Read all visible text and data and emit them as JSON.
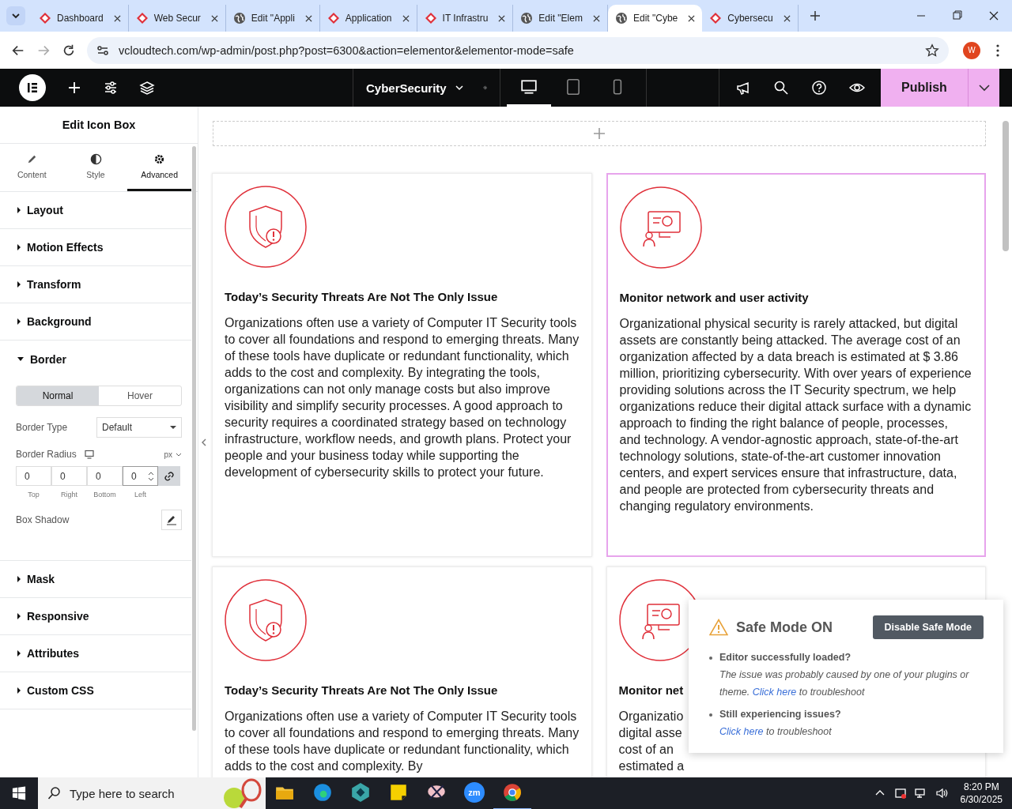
{
  "browser": {
    "tabs": [
      {
        "title": "Dashboard",
        "kind": "site",
        "selected": false
      },
      {
        "title": "Web Secur",
        "kind": "site",
        "selected": false
      },
      {
        "title": "Edit \"Appli",
        "kind": "globe",
        "selected": false
      },
      {
        "title": "Application",
        "kind": "site",
        "selected": false
      },
      {
        "title": "IT Infrastru",
        "kind": "site",
        "selected": false
      },
      {
        "title": "Edit \"Elem",
        "kind": "globe",
        "selected": false
      },
      {
        "title": "Edit \"Cybe",
        "kind": "globe",
        "selected": true
      },
      {
        "title": "Cybersecu",
        "kind": "site",
        "selected": false
      }
    ],
    "url": "vcloudtech.com/wp-admin/post.php?post=6300&action=elementor&elementor-mode=safe",
    "profile": "W"
  },
  "topbar": {
    "page_title": "CyberSecurity",
    "devices": [
      {
        "kind": "desktop",
        "selected": true
      },
      {
        "kind": "tablet",
        "selected": false
      },
      {
        "kind": "mobile",
        "selected": false
      }
    ],
    "publish": "Publish"
  },
  "panel": {
    "title": "Edit Icon Box",
    "tabs": [
      {
        "label": "Content",
        "kind": "content",
        "selected": false
      },
      {
        "label": "Style",
        "kind": "style",
        "selected": false
      },
      {
        "label": "Advanced",
        "kind": "advanced",
        "selected": true
      }
    ],
    "sections": [
      {
        "title": "Layout",
        "expanded": false
      },
      {
        "title": "Motion Effects",
        "expanded": false
      },
      {
        "title": "Transform",
        "expanded": false
      },
      {
        "title": "Background",
        "expanded": false
      },
      {
        "title": "Border",
        "expanded": true,
        "settings": {
          "states": [
            {
              "label": "Normal",
              "selected": true
            },
            {
              "label": "Hover",
              "selected": false
            }
          ],
          "border_type_label": "Border Type",
          "border_type": "Default",
          "radius_label": "Border Radius",
          "unit": "px",
          "radius": [
            {
              "value": "0",
              "label": "Top"
            },
            {
              "value": "0",
              "label": "Right"
            },
            {
              "value": "0",
              "label": "Bottom"
            },
            {
              "value": "0",
              "label": "Left"
            }
          ],
          "shadow_label": "Box Shadow"
        }
      },
      {
        "title": "Mask",
        "expanded": false
      },
      {
        "title": "Responsive",
        "expanded": false
      },
      {
        "title": "Attributes",
        "expanded": false
      },
      {
        "title": "Custom CSS",
        "expanded": false
      }
    ]
  },
  "canvas": {
    "cards": [
      {
        "kind": "shield",
        "selected": false,
        "title": "Today’s Security Threats Are Not The Only Issue",
        "lines": [
          "Organizations often use a variety of Computer IT Security tools to cover all foundations and respond to emerging threats. Many of these tools have duplicate or redundant functionality, which adds to the cost and complexity. By integrating the tools, organizations can not only manage costs but also improve visibility and simplify security processes. A good approach to security requires a coordinated strategy based on technology infrastructure, workflow needs, and growth plans. Protect your people and your business today while supporting the development of cybersecurity skills to protect your future."
        ]
      },
      {
        "kind": "monitor",
        "selected": true,
        "title": "Monitor network and user activity",
        "lines": [
          "Organizational physical security is rarely attacked, but digital assets are constantly being attacked. The average cost of an organization affected by a data breach is estimated at $ 3.86 million, prioritizing cybersecurity. With over years of experience providing solutions across the IT Security spectrum, we help organizations reduce their digital attack surface with a dynamic approach to finding the right balance of people, processes, and technology. A vendor-agnostic approach, state-of-the-art technology solutions, state-of-the-art customer innovation centers, and expert services ensure that infrastructure, data, and people are protected from cybersecurity threats and changing regulatory environments."
        ]
      },
      {
        "kind": "shield",
        "selected": false,
        "title": "Today’s Security Threats Are Not The Only Issue",
        "lines": [
          "Organizations often use a variety of Computer IT Security tools to cover all foundations and respond to emerging threats. Many of these tools have duplicate or redundant functionality, which adds to the cost and complexity. By"
        ]
      },
      {
        "kind": "monitor",
        "selected": false,
        "title": "Monitor net",
        "lines": [
          "Organizatio",
          "digital asse",
          "cost of an",
          "estimated a"
        ]
      }
    ]
  },
  "safe_mode": {
    "title": "Safe Mode ON",
    "button": "Disable Safe Mode",
    "items": [
      {
        "question": "Editor successfully loaded?",
        "note": "The issue was probably caused by one of your plugins or theme.",
        "link": "Click here",
        "after": "to troubleshoot"
      },
      {
        "question": "Still experiencing issues?",
        "link": "Click here",
        "after": "to troubleshoot"
      }
    ]
  },
  "taskbar": {
    "search_placeholder": "Type here to search",
    "zoom_app": "zm",
    "time": "8:20 PM",
    "date": "6/30/2025"
  }
}
